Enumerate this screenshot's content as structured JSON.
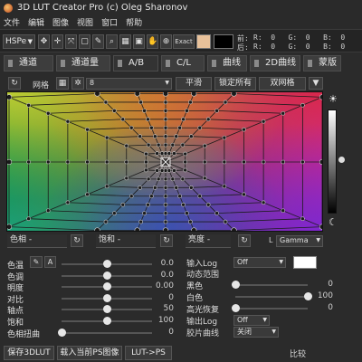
{
  "window": {
    "title": "3D LUT Creator Pro (c) Oleg Sharonov"
  },
  "menu": [
    "文件",
    "编辑",
    "图像",
    "视图",
    "窗口",
    "帮助"
  ],
  "toolbar": {
    "mode": "HSPe",
    "tools": [
      "move-icon",
      "cross-icon",
      "transform-icon",
      "rect-select-icon",
      "eyedropper-icon",
      "zoom-icon",
      "grid-icon",
      "mask-icon"
    ],
    "exact_label": "Exact",
    "swatch_before": "#e8c19a",
    "swatch_after": "#000000",
    "before_label": "前:",
    "after_label": "后:",
    "before_rgb": "R:  0   G:  0   B:  0",
    "after_rgb": "R:  0   G:  0   B:  0"
  },
  "tabs": [
    {
      "label": "通道"
    },
    {
      "label": "通道量"
    },
    {
      "label": "A/B",
      "active": true
    },
    {
      "label": "C/L"
    },
    {
      "label": "曲线"
    },
    {
      "label": "2D曲线"
    },
    {
      "label": "蒙版"
    }
  ],
  "gridbar": {
    "grid_label": "网格",
    "grid_value": "8",
    "smooth_label": "平滑",
    "lock_all_label": "锁定所有",
    "double_grid_label": "双网格"
  },
  "channels": {
    "hue_label": "色相 -",
    "sat_label": "饱和 -",
    "bri_label": "亮度 -",
    "gamma_label": "Gamma",
    "l_label": "L"
  },
  "left_sliders": [
    {
      "label": "色温",
      "value": "0.0",
      "pos": 0.5
    },
    {
      "label": "色调",
      "value": "0.0",
      "pos": 0.5
    },
    {
      "label": "明度",
      "value": "0.00",
      "pos": 0.5
    },
    {
      "label": "对比",
      "value": "0",
      "pos": 0.5
    },
    {
      "label": "轴点",
      "value": "50",
      "pos": 0.5
    },
    {
      "label": "饱和",
      "value": "100",
      "pos": 0.5
    },
    {
      "label": "色相扭曲",
      "value": "0",
      "pos": 0.0
    }
  ],
  "wb_label": "A",
  "right_panel": {
    "input_log_label": "输入Log",
    "input_log_value": "Off",
    "dynamic_range_label": "动态范围",
    "black_label": "黑色",
    "black_value": "0",
    "black_pos": 0.0,
    "white_label": "白色",
    "white_value": "100",
    "white_pos": 1.0,
    "highlight_label": "高光恢复",
    "highlight_value": "0",
    "highlight_pos": 0.0,
    "output_log_label": "输出Log",
    "output_log_value": "Off",
    "film_curve_label": "胶片曲线",
    "film_curve_value": "关闭"
  },
  "bottom": {
    "save_label": "保存3DLUT",
    "load_ps_label": "载入当前PS图像",
    "lut_ps_label": "LUT->PS",
    "compare_label": "比较"
  }
}
